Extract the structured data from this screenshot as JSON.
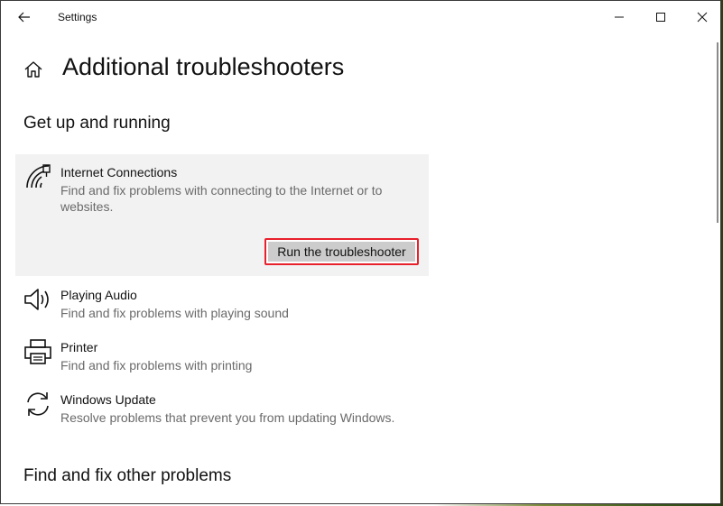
{
  "window": {
    "title": "Settings"
  },
  "header": {
    "title": "Additional troubleshooters"
  },
  "sections": [
    {
      "title": "Get up and running"
    },
    {
      "title": "Find and fix other problems"
    }
  ],
  "items": [
    {
      "icon": "wifi-icon",
      "title": "Internet Connections",
      "description": "Find and fix problems with connecting to the Internet or to websites.",
      "expanded": true,
      "button_label": "Run the troubleshooter"
    },
    {
      "icon": "speaker-icon",
      "title": "Playing Audio",
      "description": "Find and fix problems with playing sound"
    },
    {
      "icon": "printer-icon",
      "title": "Printer",
      "description": "Find and fix problems with printing"
    },
    {
      "icon": "sync-icon",
      "title": "Windows Update",
      "description": "Resolve problems that prevent you from updating Windows."
    }
  ],
  "colors": {
    "highlight_border": "#e8202b",
    "expanded_bg": "#f2f2f2",
    "button_bg": "#cccccc"
  }
}
